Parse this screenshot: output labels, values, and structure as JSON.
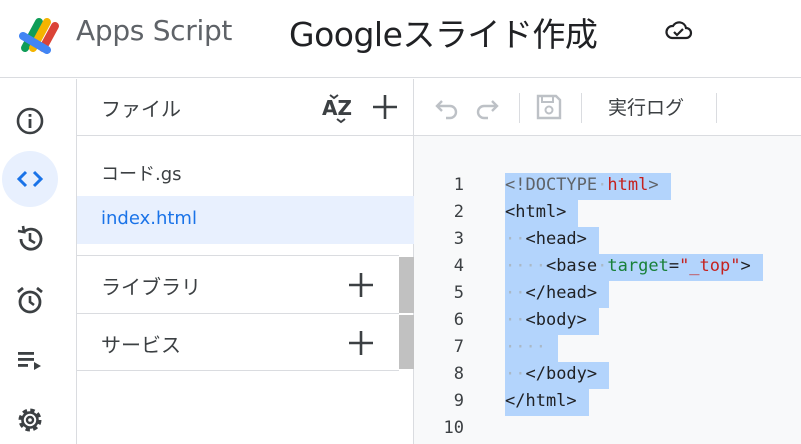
{
  "header": {
    "app_name": "Apps Script",
    "project_title": "Googleスライド作成",
    "cloud_status_icon": "cloud-sync-icon"
  },
  "rail": {
    "items": [
      {
        "icon": "info-icon",
        "active": false
      },
      {
        "icon": "code-icon",
        "active": true
      },
      {
        "icon": "history-icon",
        "active": false
      },
      {
        "icon": "alarm-icon",
        "active": false
      },
      {
        "icon": "executions-icon",
        "active": false
      },
      {
        "icon": "settings-icon",
        "active": false
      }
    ]
  },
  "files": {
    "header_label": "ファイル",
    "items": [
      {
        "name": "コード.gs",
        "selected": false
      },
      {
        "name": "index.html",
        "selected": true
      }
    ],
    "sections": [
      {
        "name": "ライブラリ"
      },
      {
        "name": "サービス"
      }
    ]
  },
  "toolbar": {
    "run_log_label": "実行ログ"
  },
  "editor": {
    "line_numbers": [
      "1",
      "2",
      "3",
      "4",
      "5",
      "6",
      "7",
      "8",
      "9",
      "10"
    ]
  },
  "colors": {
    "accent": "#1a73e8",
    "selection": "#b3d4fc",
    "active_bg": "#e8f0fe"
  }
}
